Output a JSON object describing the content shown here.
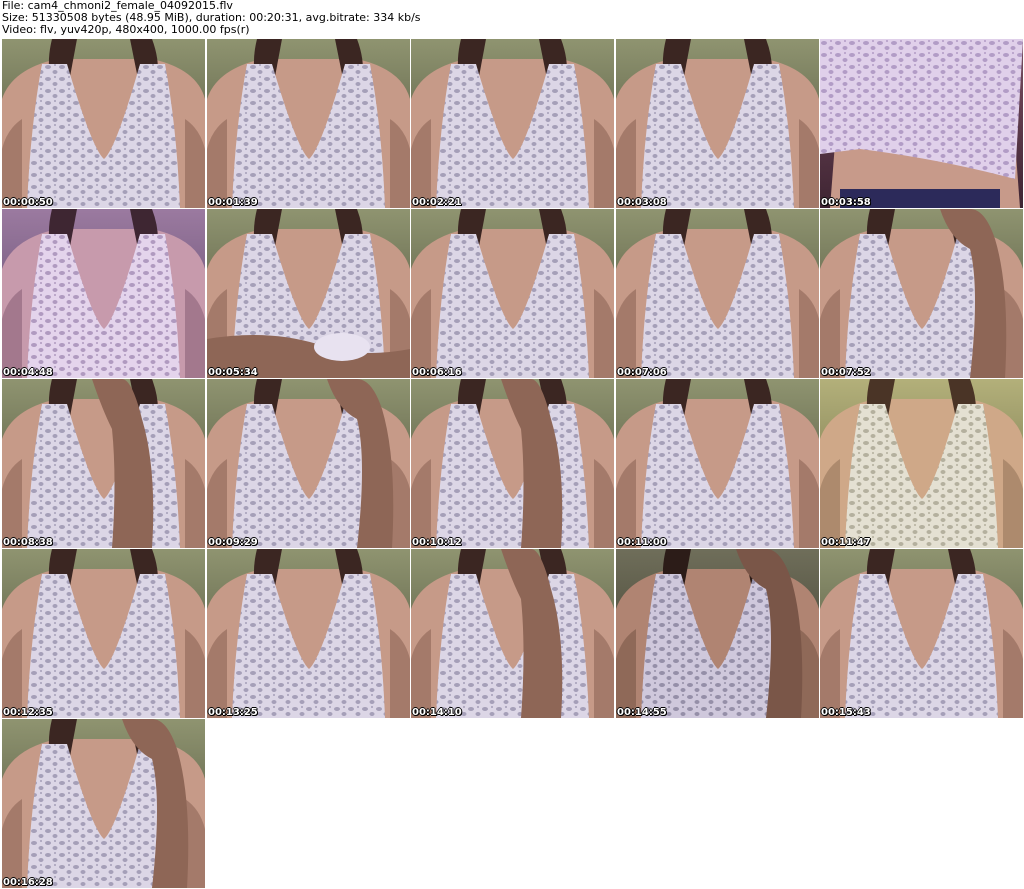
{
  "header": {
    "file_line": "File: cam4_chmoni2_female_04092015.flv",
    "size_line": "Size: 51330508 bytes (48.95 MiB), duration: 00:20:31, avg.bitrate: 334 kb/s",
    "video_line": "Video: flv, yuv420p, 480x400, 1000.00 fps(r)"
  },
  "thumbnails": [
    {
      "timestamp": "00:00:50",
      "hand": "none",
      "variant": "normal"
    },
    {
      "timestamp": "00:01:39",
      "hand": "none",
      "variant": "normal"
    },
    {
      "timestamp": "00:02:21",
      "hand": "none",
      "variant": "normal"
    },
    {
      "timestamp": "00:03:08",
      "hand": "none",
      "variant": "normal"
    },
    {
      "timestamp": "00:03:58",
      "hand": "none",
      "variant": "lifted"
    },
    {
      "timestamp": "00:04:48",
      "hand": "none",
      "variant": "purple"
    },
    {
      "timestamp": "00:05:34",
      "hand": "arms",
      "variant": "normal"
    },
    {
      "timestamp": "00:06:16",
      "hand": "none",
      "variant": "normal"
    },
    {
      "timestamp": "00:07:06",
      "hand": "none",
      "variant": "normal"
    },
    {
      "timestamp": "00:07:52",
      "hand": "right",
      "variant": "normal"
    },
    {
      "timestamp": "00:08:38",
      "hand": "center",
      "variant": "normal"
    },
    {
      "timestamp": "00:09:29",
      "hand": "right",
      "variant": "normal"
    },
    {
      "timestamp": "00:10:12",
      "hand": "center",
      "variant": "normal"
    },
    {
      "timestamp": "00:11:00",
      "hand": "none",
      "variant": "normal"
    },
    {
      "timestamp": "00:11:47",
      "hand": "none",
      "variant": "yellow"
    },
    {
      "timestamp": "00:12:35",
      "hand": "none",
      "variant": "normal"
    },
    {
      "timestamp": "00:13:25",
      "hand": "none",
      "variant": "normal"
    },
    {
      "timestamp": "00:14:10",
      "hand": "center",
      "variant": "normal"
    },
    {
      "timestamp": "00:14:55",
      "hand": "right",
      "variant": "dark"
    },
    {
      "timestamp": "00:15:43",
      "hand": "none",
      "variant": "normal"
    },
    {
      "timestamp": "00:16:28",
      "hand": "right",
      "variant": "normal"
    }
  ]
}
